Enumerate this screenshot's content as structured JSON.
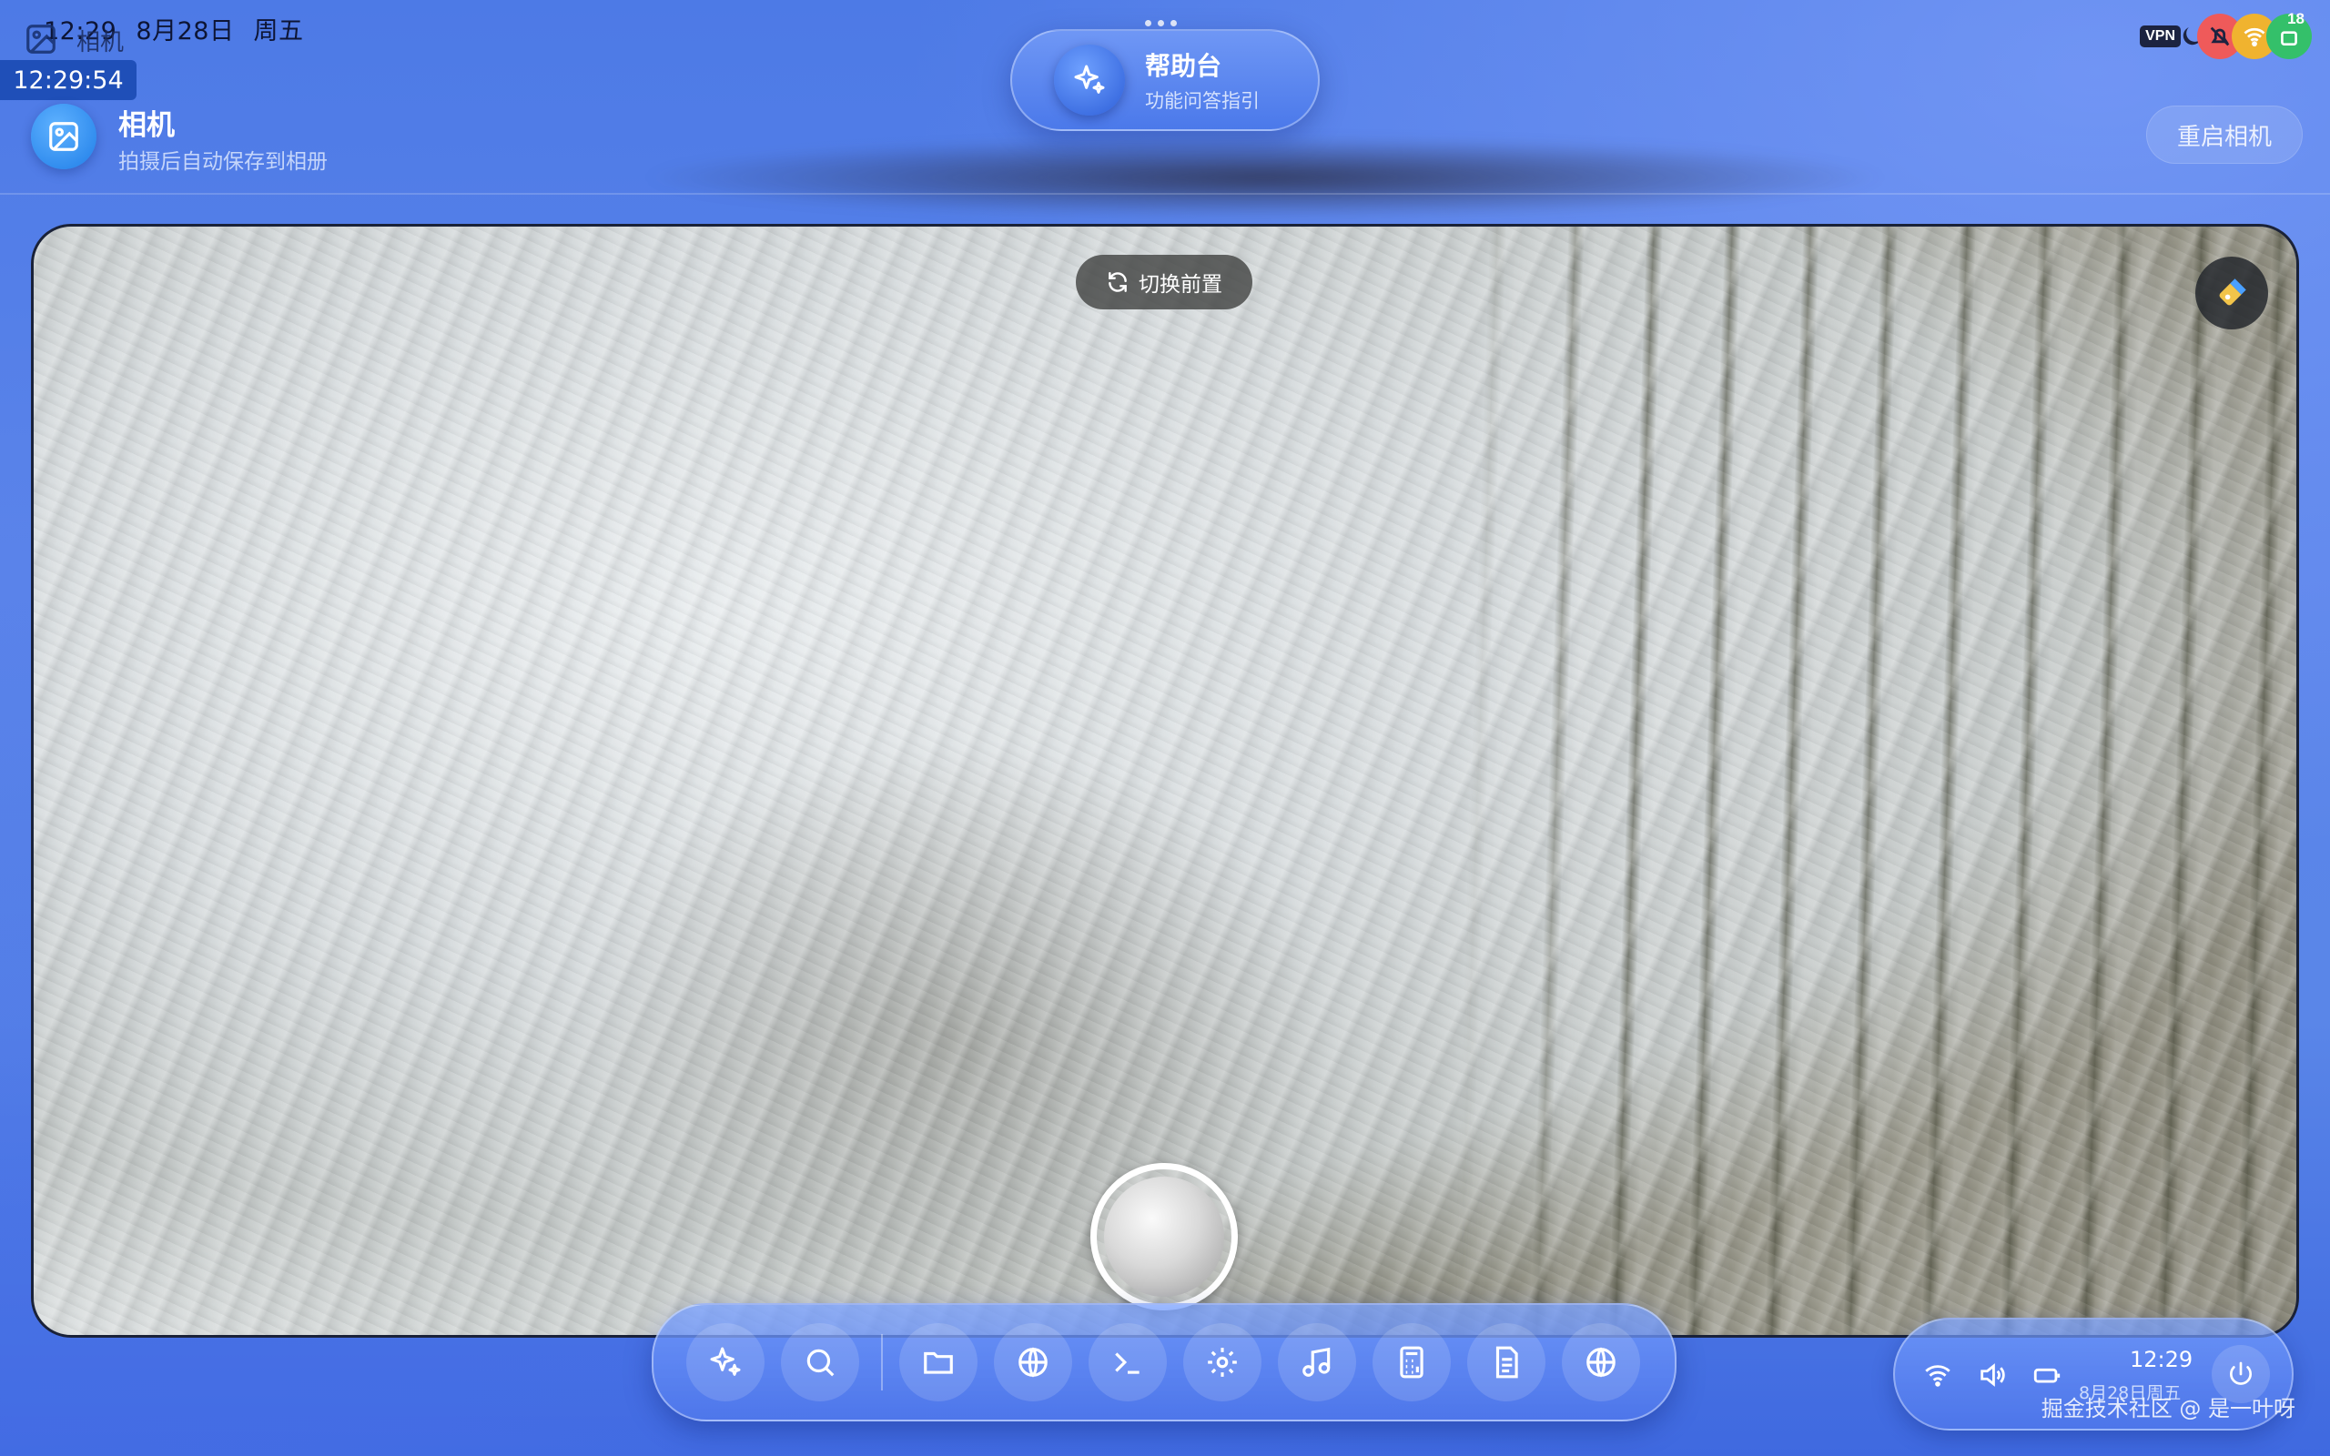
{
  "status_bar": {
    "time": "12:29",
    "date": "8月28日",
    "weekday": "周五",
    "vpn_label": "VPN",
    "notification_count": "18",
    "seconds_clock": "12:29:54"
  },
  "window": {
    "title": "相机"
  },
  "help_pill": {
    "title": "帮助台",
    "subtitle": "功能问答指引"
  },
  "app_header": {
    "title": "相机",
    "subtitle": "拍摄后自动保存到相册",
    "restart_label": "重启相机"
  },
  "camera": {
    "switch_label": "切换前置"
  },
  "dock": {
    "items": [
      "sparkle-icon",
      "search-icon",
      "folder-icon",
      "globe-icon",
      "terminal-icon",
      "gear-icon",
      "music-icon",
      "calculator-icon",
      "document-icon",
      "globe-icon"
    ]
  },
  "tray": {
    "time": "12:29",
    "date": "8月28日周五"
  },
  "watermark": "掘金技术社区 @ 是一叶呀",
  "colors": {
    "background": "#5b84ea",
    "accent": "#2d5ed8",
    "status_red": "#ef5a5a",
    "status_yellow": "#f0b32f",
    "status_green": "#34c06a"
  }
}
